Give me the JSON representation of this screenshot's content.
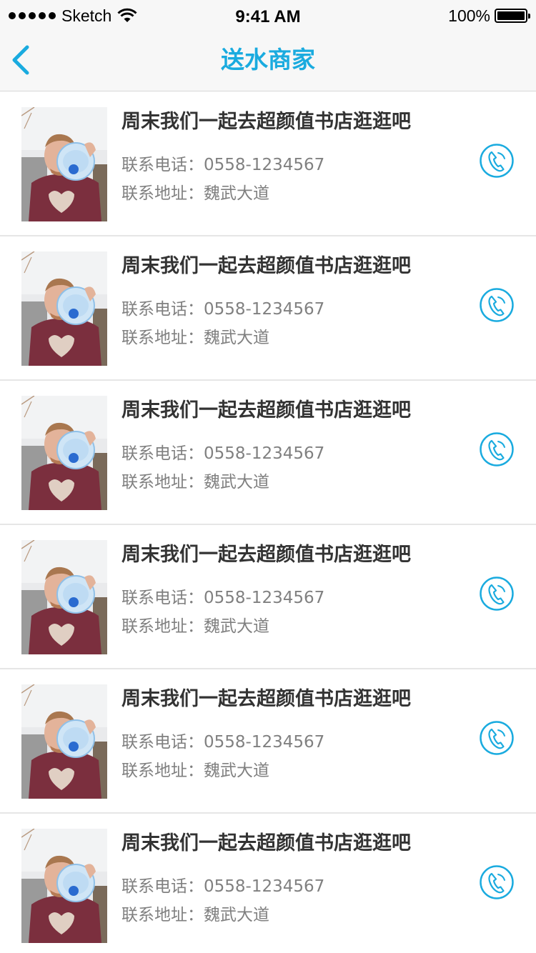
{
  "status_bar": {
    "carrier": "Sketch",
    "time": "9:41 AM",
    "battery": "100%",
    "signal_icon": "signal-dots-icon",
    "wifi_icon": "wifi-icon",
    "battery_icon": "battery-icon"
  },
  "nav": {
    "title": "送水商家",
    "back_icon": "chevron-left-icon"
  },
  "colors": {
    "accent": "#1aabdf",
    "title_text": "#333333",
    "secondary_text": "#808080",
    "divider": "#e6e6e6"
  },
  "merchants": [
    {
      "name": "周末我们一起去超颜值书店逛逛吧",
      "phone_label": "联系电话：",
      "phone": "0558-1234567",
      "address_label": "联系地址：",
      "address": "魏武大道",
      "call_icon": "phone-call-icon"
    },
    {
      "name": "周末我们一起去超颜值书店逛逛吧",
      "phone_label": "联系电话：",
      "phone": "0558-1234567",
      "address_label": "联系地址：",
      "address": "魏武大道",
      "call_icon": "phone-call-icon"
    },
    {
      "name": "周末我们一起去超颜值书店逛逛吧",
      "phone_label": "联系电话：",
      "phone": "0558-1234567",
      "address_label": "联系地址：",
      "address": "魏武大道",
      "call_icon": "phone-call-icon"
    },
    {
      "name": "周末我们一起去超颜值书店逛逛吧",
      "phone_label": "联系电话：",
      "phone": "0558-1234567",
      "address_label": "联系地址：",
      "address": "魏武大道",
      "call_icon": "phone-call-icon"
    },
    {
      "name": "周末我们一起去超颜值书店逛逛吧",
      "phone_label": "联系电话：",
      "phone": "0558-1234567",
      "address_label": "联系地址：",
      "address": "魏武大道",
      "call_icon": "phone-call-icon"
    },
    {
      "name": "周末我们一起去超颜值书店逛逛吧",
      "phone_label": "联系电话：",
      "phone": "0558-1234567",
      "address_label": "联系地址：",
      "address": "魏武大道",
      "call_icon": "phone-call-icon"
    }
  ]
}
